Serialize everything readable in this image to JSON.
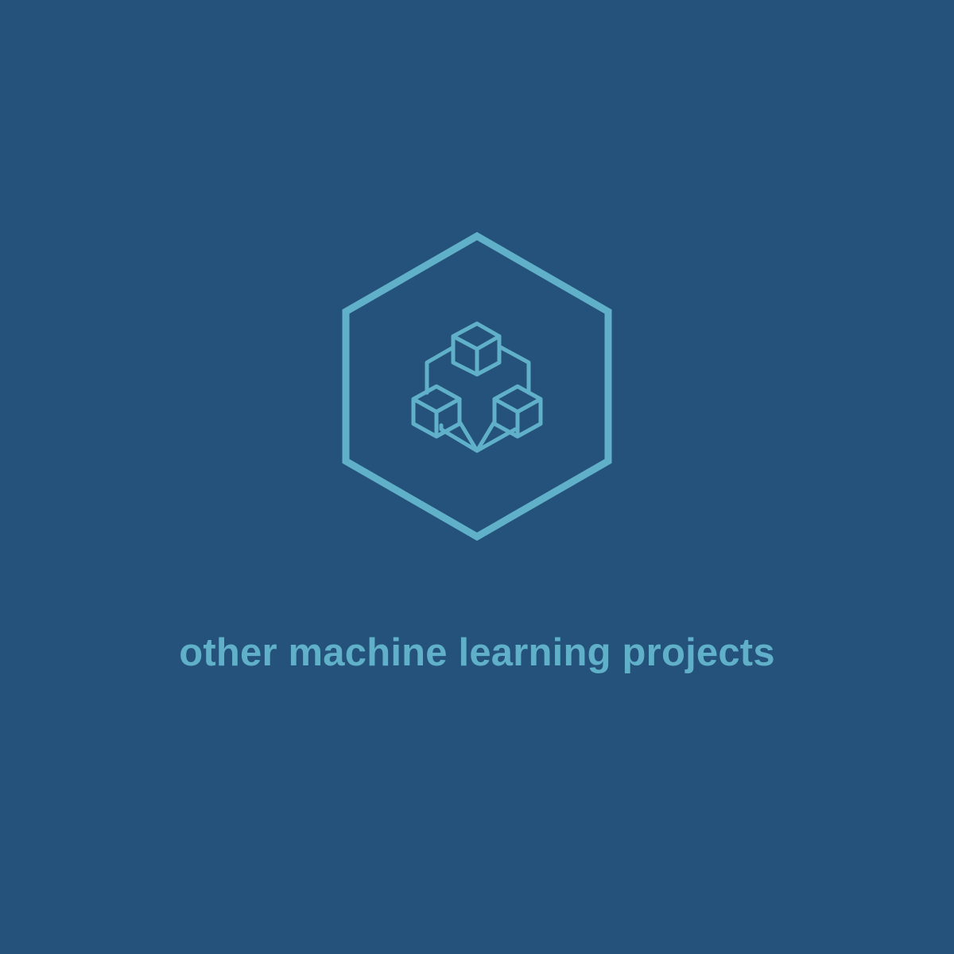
{
  "background_color": "#25527b",
  "accent_color": "#5fb0c8",
  "logo": {
    "frame_icon": "hexagon-frame-icon",
    "icon": "connected-cubes-icon"
  },
  "caption": "other machine learning projects"
}
